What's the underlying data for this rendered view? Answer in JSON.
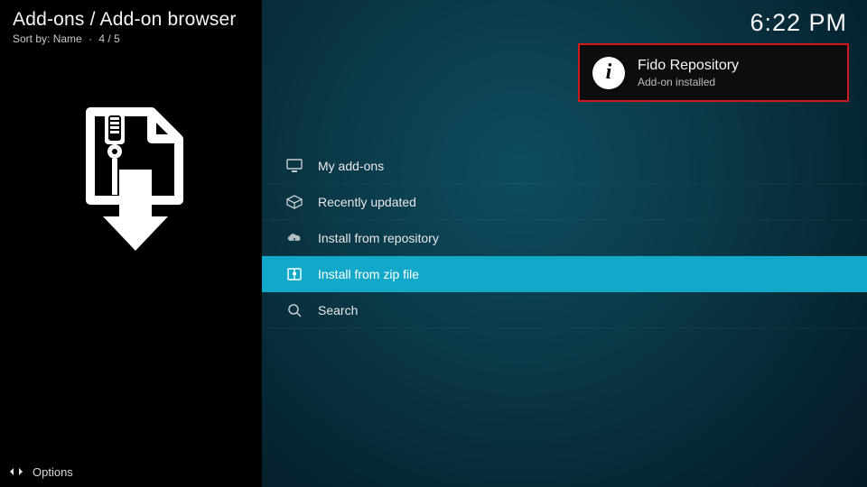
{
  "breadcrumb": "Add-ons / Add-on browser",
  "sort": {
    "label": "Sort by:",
    "value": "Name",
    "position": "4 / 5"
  },
  "clock": "6:22 PM",
  "menu": {
    "items": [
      {
        "label": "My add-ons",
        "icon": "monitor-icon",
        "selected": false
      },
      {
        "label": "Recently updated",
        "icon": "box-icon",
        "selected": false
      },
      {
        "label": "Install from repository",
        "icon": "cloud-down-icon",
        "selected": false
      },
      {
        "label": "Install from zip file",
        "icon": "zip-icon",
        "selected": true
      },
      {
        "label": "Search",
        "icon": "search-icon",
        "selected": false
      }
    ]
  },
  "notification": {
    "title": "Fido Repository",
    "subtitle": "Add-on installed"
  },
  "footer": {
    "options": "Options"
  },
  "colors": {
    "accent": "#12a8c9",
    "highlight_border": "#d11b1b"
  }
}
